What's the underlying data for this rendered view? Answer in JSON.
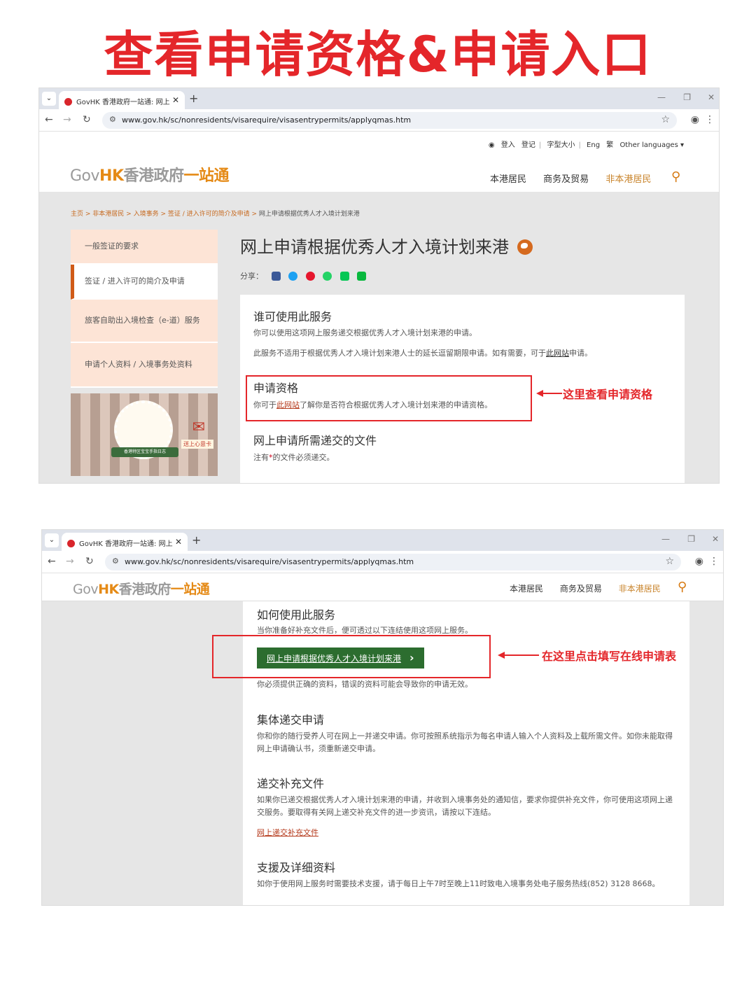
{
  "title": "查看申请资格&申请入口",
  "browser": {
    "tab_title": "GovHK 香港政府一站通: 网上",
    "tab_close": "✕",
    "new_tab": "+",
    "url": "www.gov.hk/sc/nonresidents/visarequire/visasentrypermits/applyqmas.htm"
  },
  "site": {
    "logo_gov": "Gov",
    "logo_hk": "HK",
    "logo_zh": "香港政府",
    "logo_one": "一站通",
    "util": {
      "login": "登入",
      "register": "登记",
      "font_size": "字型大小",
      "eng": "Eng",
      "trad": "繁",
      "other_lang": "Other languages"
    },
    "nav": [
      "本港居民",
      "商务及贸易",
      "非本港居民"
    ],
    "breadcrumb": [
      "主页",
      "非本港居民",
      "入境事务",
      "签证 / 进入许可的简介及申请",
      "网上申请根据优秀人才入境计划来港"
    ],
    "sidebar": [
      "一般签证的要求",
      "签证 / 进入许可的简介及申请",
      "旅客自助出入境检查（e-道）服务",
      "申请个人资料 / 入境事务处资料"
    ],
    "banner_tag": "送上心意卡",
    "banner_ribbon": "香港特区宝宝手指日志",
    "page_heading": "网上申请根据优秀人才入境计划来港",
    "share_label": "分享："
  },
  "section1": {
    "who_title": "谁可使用此服务",
    "who_p1": "你可以使用这项网上服务递交根据优秀人才入境计划来港的申请。",
    "who_p2_a": "此服务不适用于根据优秀人才入境计划来港人士的延长逗留期限申请。如有需要，可于",
    "who_p2_link": "此网站",
    "who_p2_b": "申请。",
    "elig_title": "申请资格",
    "elig_p_a": "你可于",
    "elig_p_link": "此网站",
    "elig_p_b": "了解你是否符合根据优秀人才入境计划来港的申请资格。",
    "docs_title": "网上申请所需递交的文件",
    "docs_p_a": "注有",
    "docs_p_star": "*",
    "docs_p_b": "的文件必须递交。",
    "annotation": "这里查看申请资格"
  },
  "section2": {
    "how_title": "如何使用此服务",
    "how_p": "当你准备好补充文件后，便可透过以下连结使用这项网上服务。",
    "apply_btn": "网上申请根据优秀人才入境计划来港",
    "warn_p": "你必须提供正确的资料，错误的资料可能会导致你的申请无效。",
    "group_title": "集体递交申请",
    "group_p": "你和你的随行受养人可在网上一并递交申请。你可按照系统指示为每名申请人输入个人资料及上载所需文件。如你未能取得网上申请确认书，须重新递交申请。",
    "supp_title": "递交补充文件",
    "supp_p": "如果你已递交根据优秀人才入境计划来港的申请，并收到入境事务处的通知信，要求你提供补充文件，你可使用这项网上递交服务。要取得有关网上递交补充文件的进一步资讯，请按以下连结。",
    "supp_link": "网上递交补充文件",
    "support_title": "支援及详细资料",
    "support_p": "如你于使用网上服务时需要技术支援，请于每日上午7时至晚上11时致电入境事务处电子服务热线(852) 3128 8668。",
    "annotation": "在这里点击填写在线申请表"
  }
}
